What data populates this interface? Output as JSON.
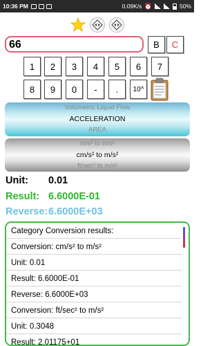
{
  "status": {
    "time": "10:36 PM",
    "net_speed": "0.09K/s",
    "battery": "50%"
  },
  "toolbar": {
    "icons": [
      "star-icon",
      "diamond-arrows-icon",
      "diamond-arrows-icon"
    ]
  },
  "input": {
    "value": "66"
  },
  "buttons": {
    "b": "B",
    "c": "C"
  },
  "keypad": {
    "row1": [
      "1",
      "2",
      "3",
      "4",
      "5",
      "6",
      "7"
    ],
    "row2": [
      "8",
      "9",
      "0",
      "-",
      ".",
      "10^"
    ]
  },
  "category_wheel": {
    "items": [
      "Volumetric Liquid Flow",
      "ACCELERATION",
      "AREA"
    ]
  },
  "unit_wheel": {
    "items": [
      "m/s² to in/s²",
      "cm/s² to  m/s²",
      "ft/sec² to m/s²"
    ]
  },
  "summary": {
    "unit_label": "Unit:",
    "unit_value": "0.01",
    "result_label": "Result:",
    "result_value": "6.6000E-01",
    "reverse_label": "Reverse:",
    "reverse_value": "6.6000E+03"
  },
  "colors": {
    "result": "#2db82d",
    "reverse": "#6ec1e4",
    "border_green": "#46b946",
    "input_border": "#e06070"
  },
  "results_list": [
    "Category Conversion results:",
    "Conversion: cm/s² to  m/s²",
    "Unit: 0.01",
    "Result: 6.6000E-01",
    "Reverse: 6.6000E+03",
    "Conversion: ft/sec² to m/s²",
    "Unit: 0.3048",
    "Result: 2.01175+01"
  ]
}
